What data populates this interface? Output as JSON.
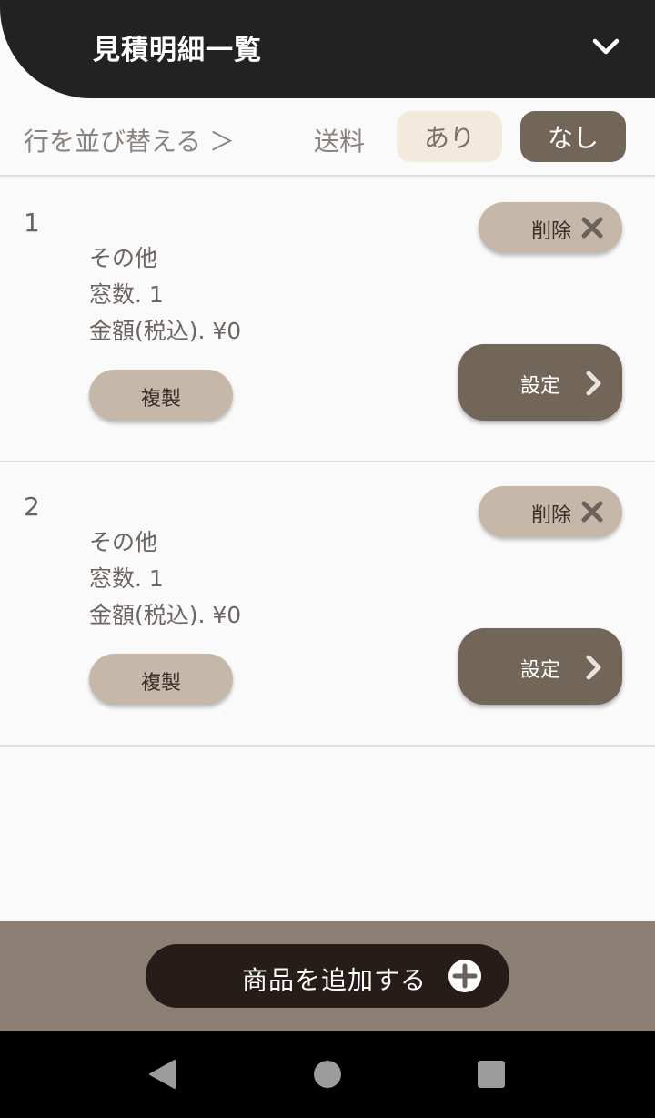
{
  "header": {
    "title": "見積明細一覧",
    "toggle_icon": "chevron-down-icon"
  },
  "toolbar": {
    "reorder_label": "行を並び替える ＞",
    "shipping_label": "送料",
    "shipping_yes": "あり",
    "shipping_no": "なし",
    "shipping_selected": "なし"
  },
  "items": [
    {
      "index": "1",
      "name": "その他",
      "windows": "窓数. 1",
      "amount": "金額(税込). ¥0",
      "delete_label": "削除",
      "copy_label": "複製",
      "settings_label": "設定"
    },
    {
      "index": "2",
      "name": "その他",
      "windows": "窓数. 1",
      "amount": "金額(税込). ¥0",
      "delete_label": "削除",
      "copy_label": "複製",
      "settings_label": "設定"
    }
  ],
  "footer": {
    "add_label": "商品を追加する",
    "add_icon": "plus-circle-icon"
  },
  "colors": {
    "header_bg": "#222222",
    "accent_dark": "#726658",
    "accent_light": "#c6b8a8",
    "pill_light": "#f2eadd",
    "footer_bg": "#8c8075",
    "add_button_bg": "#261c18"
  }
}
